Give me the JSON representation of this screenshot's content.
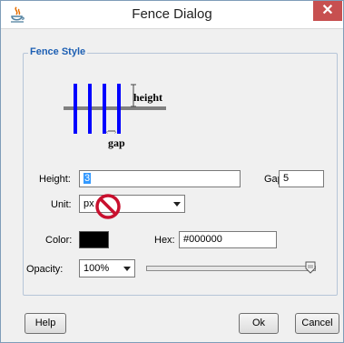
{
  "window": {
    "title": "Fence Dialog",
    "close_symbol": "✕",
    "app_icon": "java-icon"
  },
  "group": {
    "title": "Fence Style"
  },
  "preview": {
    "height_label": "height",
    "gap_label": "gap",
    "post_color": "#0000ff",
    "rail_color": "#808080"
  },
  "form": {
    "height_label": "Height:",
    "height_value": "3",
    "gap_label": "Gap:",
    "gap_value": "5",
    "unit_label": "Unit:",
    "unit_value": "px",
    "color_label": "Color:",
    "color_value": "#000000",
    "hex_label": "Hex:",
    "hex_value": "#000000",
    "opacity_label": "Opacity:",
    "opacity_value": "100%",
    "opacity_level": 1.0
  },
  "buttons": {
    "help": "Help",
    "ok": "Ok",
    "cancel": "Cancel"
  },
  "cursor": "not-allowed-cursor-icon"
}
